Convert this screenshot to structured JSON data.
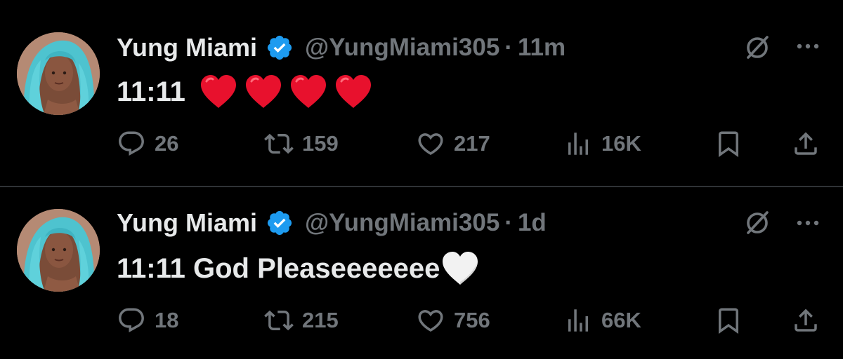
{
  "colors": {
    "background": "#000000",
    "primary_text": "#e7e9ea",
    "secondary_text": "#71767b",
    "divider": "#2f3336",
    "verified_badge": "#1d9bf0",
    "red_heart": "#e8112d",
    "white_heart": "#f2f2f2"
  },
  "tweets": [
    {
      "display_name": "Yung Miami",
      "handle": "@YungMiami305",
      "separator": "·",
      "time": "11m",
      "text": "11:11",
      "emojis": [
        "red-heart",
        "red-heart",
        "red-heart",
        "red-heart"
      ],
      "replies": "26",
      "reposts": "159",
      "likes": "217",
      "views": "16K"
    },
    {
      "display_name": "Yung Miami",
      "handle": "@YungMiami305",
      "separator": "·",
      "time": "1d",
      "text": "11:11 God Pleaseeeeeee",
      "emojis": [
        "white-heart"
      ],
      "replies": "18",
      "reposts": "215",
      "likes": "756",
      "views": "66K"
    }
  ],
  "icons": {
    "verified": "verified-badge-icon",
    "grok": "grok-icon",
    "more": "more-options-icon",
    "reply": "reply-icon",
    "repost": "repost-icon",
    "like": "heart-icon",
    "views": "views-icon",
    "bookmark": "bookmark-icon",
    "share": "share-icon"
  }
}
